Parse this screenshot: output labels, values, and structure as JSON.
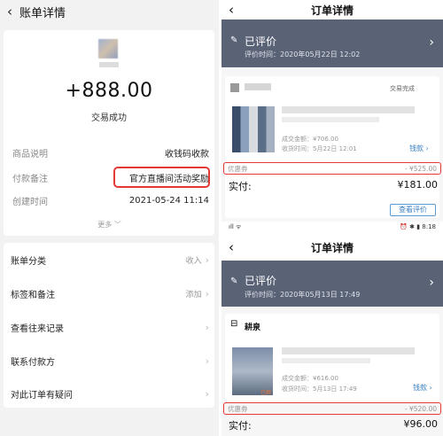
{
  "left": {
    "back_icon": "‹",
    "title": "账单详情",
    "avatar_name": "**",
    "amount": "+888.00",
    "status": "交易成功",
    "rows": [
      {
        "k": "商品说明",
        "v": "收钱码收款"
      },
      {
        "k": "付款备注",
        "v": "官方直播间活动奖励"
      },
      {
        "k": "创建时间",
        "v": "2021-05-24 11:14"
      }
    ],
    "more": "更多 ﹀",
    "menu": [
      {
        "label": "账单分类",
        "right": "收入"
      },
      {
        "label": "标签和备注",
        "right": "添加"
      },
      {
        "label": "查看往来记录",
        "right": ""
      },
      {
        "label": "联系付款方",
        "right": ""
      },
      {
        "label": "对此订单有疑问",
        "right": ""
      }
    ],
    "chevron": "›"
  },
  "top": {
    "title": "订单详情",
    "eval_title": "已评价",
    "eval_time": "评价时间：2020年05月22日 12:02",
    "trade_status": "交易完成",
    "amount_line": "成交金额：¥706.00",
    "time_line": "收货时间：5月22日 12:01",
    "refund": "钱款 ›",
    "discount_label": "优惠券",
    "discount_value": "- ¥525.00",
    "actual_label": "实付:",
    "actual_value": "¥181.00",
    "eval_button": "查看评价",
    "status_left": "ıll ᯤ",
    "status_right": "⏰ ✱ ▮ 8:18"
  },
  "bottom": {
    "title": "订单详情",
    "eval_title": "已评价",
    "eval_time": "评价时间：2020年05月13日 17:49",
    "store": "耕泉",
    "amount_line": "成交金额：¥616.00",
    "time_line": "收货时间：5月13日 17:49",
    "refund": "钱款 ›",
    "tag": "已解",
    "discount_label": "优惠券",
    "discount_value": "- ¥520.00",
    "actual_label": "实付:",
    "actual_value": "¥96.00"
  },
  "colors": {
    "band": "#5a6276",
    "highlight": "#e53935",
    "accent": "#3a7fc0"
  }
}
